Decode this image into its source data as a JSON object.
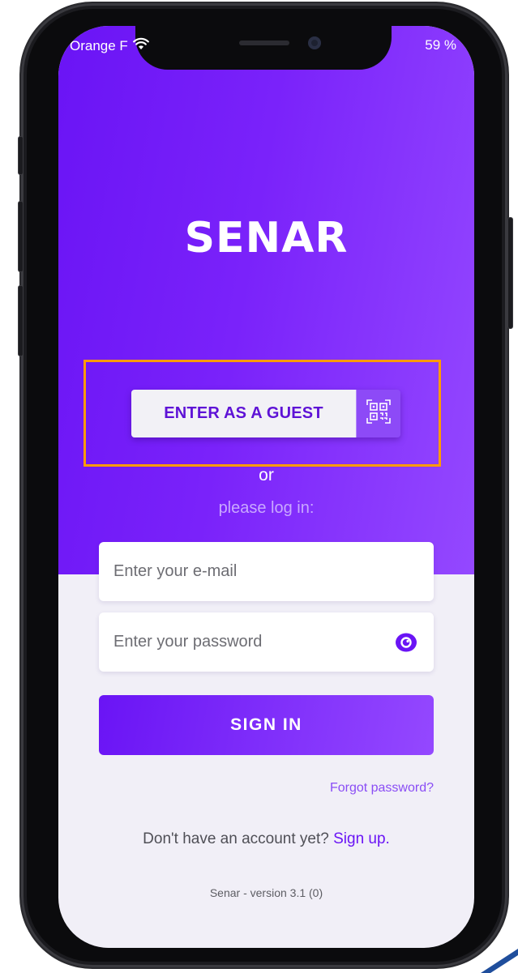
{
  "status_bar": {
    "carrier": "Orange F",
    "battery": "59 %"
  },
  "app": {
    "logo": "SENAR"
  },
  "guest": {
    "label": "ENTER AS A GUEST"
  },
  "separator": {
    "or": "or",
    "login_prompt": "please log in:"
  },
  "form": {
    "email_placeholder": "Enter your e-mail",
    "password_placeholder": "Enter your password",
    "signin_label": "SIGN IN",
    "forgot_label": "Forgot password?"
  },
  "signup": {
    "prompt": "Don't have an account yet?",
    "link": "Sign up."
  },
  "footer": {
    "version": "Senar - version 3.1 (0)"
  },
  "colors": {
    "brand_purple": "#6a14f5",
    "brand_purple_light": "#9448ff",
    "highlight_orange": "#ff9a00"
  },
  "icons": [
    "wifi-icon",
    "qr-code-icon",
    "eye-icon"
  ]
}
